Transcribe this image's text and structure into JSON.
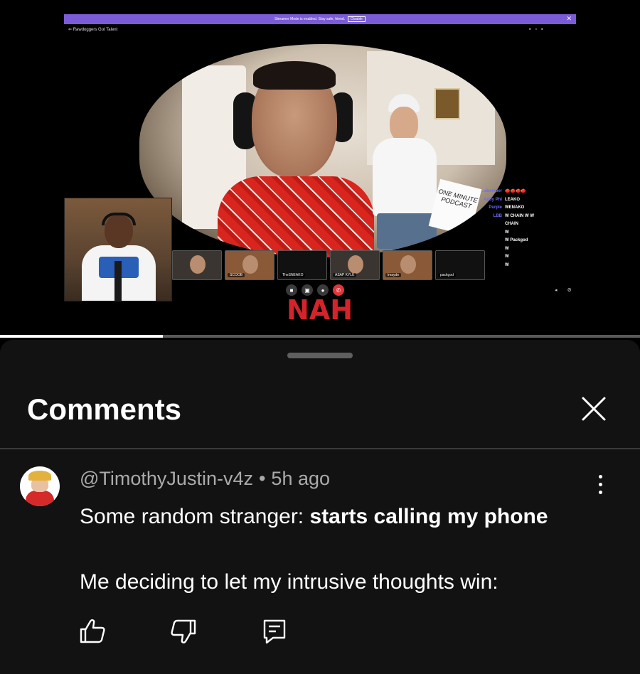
{
  "video": {
    "banner_text": "Streamer Mode is enabled. Stay safe, friend.",
    "banner_button": "Disable",
    "stream_title": "Rawdoggers Got Talent",
    "sign_text": "ONE MINUTE PODCAST",
    "overlay_caption": "NAH",
    "tiles": [
      {
        "label": ""
      },
      {
        "label": "SCOOB"
      },
      {
        "label": "TheSNEAKO"
      },
      {
        "label": "ASAP KYLE"
      },
      {
        "label": "lmayde"
      },
      {
        "label": "packgod"
      }
    ],
    "chat": [
      {
        "user": "..ebember",
        "msg": "🍅🍅🍅🍅"
      },
      {
        "user": "Andy Phi",
        "msg": "LEAKO"
      },
      {
        "user": "Purple",
        "msg": "WENAKO"
      },
      {
        "user": "LBB",
        "msg": "W CHAIN W W"
      },
      {
        "user": "",
        "msg": "CHAIN"
      },
      {
        "user": "",
        "msg": "W"
      },
      {
        "user": "",
        "msg": "W Packgod"
      },
      {
        "user": "",
        "msg": "W"
      },
      {
        "user": "",
        "msg": "W"
      },
      {
        "user": "",
        "msg": "W"
      }
    ],
    "progress": 0.254
  },
  "sheet": {
    "title": "Comments"
  },
  "comment": {
    "author": "@TimothyJustin-v4z",
    "separator": "•",
    "time": "5h ago",
    "line1_prefix": "Some random stranger: ",
    "line1_bold": "starts calling my phone",
    "line2": "Me deciding to let my intrusive thoughts win:"
  },
  "icons": {
    "close": "close-icon",
    "more": "more-vert-icon",
    "like": "thumb-up-icon",
    "dislike": "thumb-down-icon",
    "reply": "reply-icon"
  },
  "colors": {
    "banner": "#7b5cd6",
    "caption": "#d4232a",
    "sheet_bg": "#121212",
    "meta_text": "#aaaaaa"
  }
}
